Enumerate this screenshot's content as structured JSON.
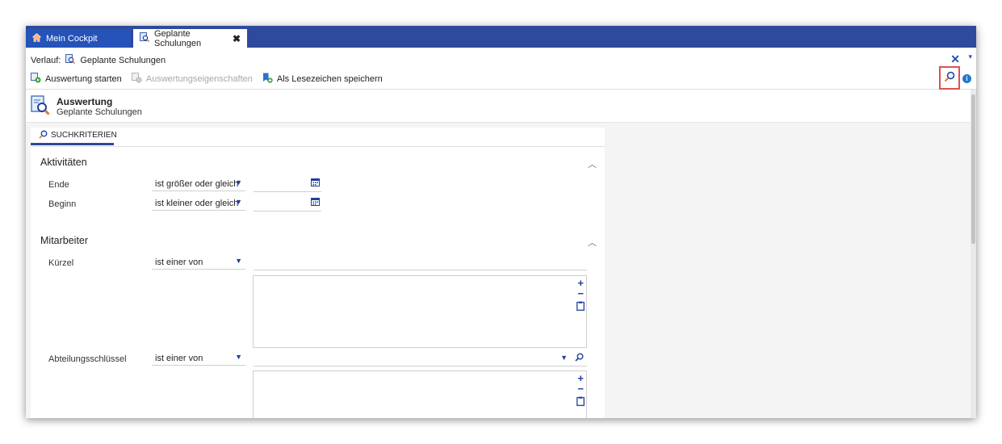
{
  "tabs": [
    {
      "label": "Mein Cockpit",
      "icon": "home-icon",
      "active": false
    },
    {
      "label": "Geplante Schulungen",
      "icon": "report-icon",
      "active": true,
      "close": "✖"
    }
  ],
  "history": {
    "label": "Verlauf:",
    "item": "Geplante Schulungen"
  },
  "window_controls": {
    "close": "✕",
    "menu": "▾"
  },
  "toolbar": {
    "start": "Auswertung starten",
    "properties": "Auswertungseigenschaften",
    "bookmark": "Als Lesezeichen speichern"
  },
  "header": {
    "title": "Auswertung",
    "subtitle": "Geplante Schulungen"
  },
  "search_tab": {
    "label": "SUCHKRITERIEN"
  },
  "sections": {
    "activities": {
      "title": "Aktivitäten",
      "end_label": "Ende",
      "end_op": "ist größer oder gleich",
      "begin_label": "Beginn",
      "begin_op": "ist kleiner oder gleich"
    },
    "employees": {
      "title": "Mitarbeiter",
      "short_label": "Kürzel",
      "short_op": "ist einer von",
      "dept_label": "Abteilungsschlüssel",
      "dept_op": "ist einer von"
    }
  },
  "glyphs": {
    "chevron_up": "︿",
    "dropdown": "▼",
    "plus": "+",
    "minus": "−",
    "info": "i"
  },
  "colors": {
    "brand": "#2d4a9c",
    "active_tab": "#2553b8",
    "highlight": "#e05050",
    "accent": "#1e3f9e"
  }
}
